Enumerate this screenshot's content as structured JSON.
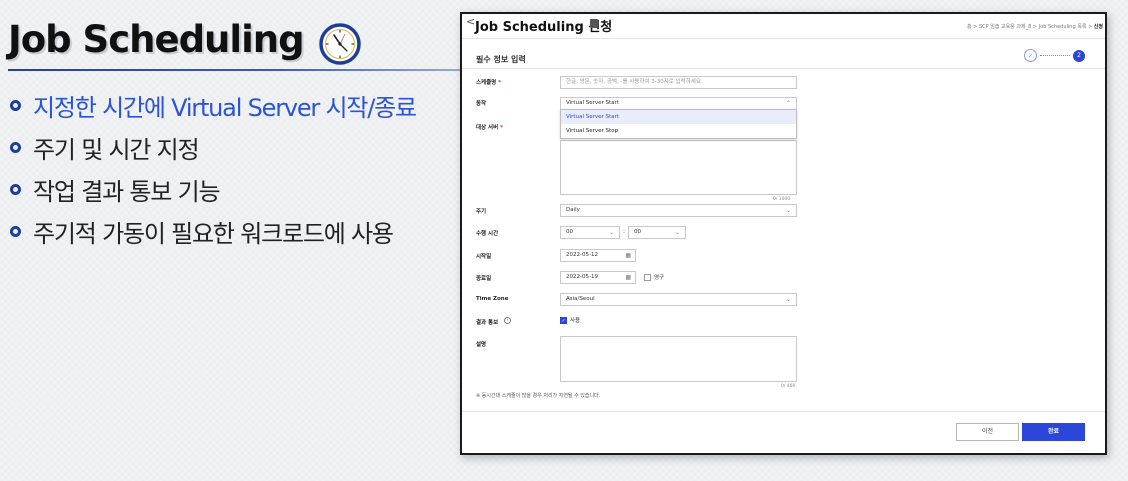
{
  "slide": {
    "title": "Job Scheduling",
    "bullets": [
      "지정한 시간에 Virtual Server 시작/종료",
      "주기 및 시간 지정",
      "작업 결과 통보 기능",
      "주기적 가동이 필요한 워크로드에 사용"
    ],
    "accent_color": "#2a53d6",
    "icon": "clock-icon"
  },
  "window": {
    "back": "<",
    "title": "Job Scheduling 신청",
    "breadcrumb_path": "홈 > SCP 임습 교육용 과제_8 > Job Scheduling 목록 >",
    "breadcrumb_current": "신청",
    "section_title": "필수 정보 입력",
    "steps": {
      "done_mark": "✓",
      "current": "2"
    },
    "form": {
      "schedule_name": {
        "label": "스케줄명",
        "placeholder": "한글, 영문, 숫자, 공백, -를 사용하여 3-30자로 입력하세요."
      },
      "action": {
        "label": "동작",
        "value": "Virtual Server Start",
        "options": [
          "Virtual Server Start",
          "Virtual Server Stop"
        ]
      },
      "target_server": {
        "label": "대상 서버",
        "count": "0/ 1000"
      },
      "cycle": {
        "label": "주기",
        "value": "Daily"
      },
      "run_time": {
        "label": "수행 시간",
        "hour": "00",
        "minute": "00",
        "separator": ":"
      },
      "start_date": {
        "label": "시작일",
        "value": "2022-05-12"
      },
      "end_date": {
        "label": "종료일",
        "value": "2022-05-19",
        "permanent_label": "영구"
      },
      "timezone": {
        "label": "Time Zone",
        "value": "Asia/Seoul"
      },
      "notify": {
        "label": "결과 통보",
        "checkbox_label": "사용",
        "checked": true
      },
      "description": {
        "label": "설명",
        "count": "0/ 400"
      }
    },
    "note": "※ 동시간대 스케줄이 많을 경우 처리가 지연될 수 있습니다.",
    "buttons": {
      "prev": "이전",
      "done": "완료"
    },
    "primary_color": "#2b46d8"
  }
}
